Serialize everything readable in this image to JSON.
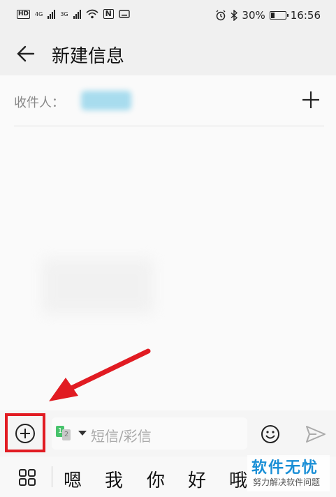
{
  "status_bar": {
    "hd": "HD",
    "net1": "4G",
    "net2": "3G",
    "nfc": "N",
    "battery_percent": "30%",
    "battery_level": 0.3,
    "time": "16:56",
    "icons": [
      "alarm-icon",
      "bluetooth-icon",
      "wifi-icon",
      "keyboard-icon"
    ]
  },
  "header": {
    "title": "新建信息"
  },
  "recipient": {
    "label": "收件人："
  },
  "compose": {
    "placeholder": "短信/彩信",
    "sim_1": "1",
    "sim_2": "2"
  },
  "keyboard": {
    "candidates": [
      "嗯",
      "我",
      "你",
      "好",
      "哦"
    ]
  },
  "watermark": {
    "title": "软件无忧",
    "subtitle": "努力解决软件问题"
  },
  "colors": {
    "highlight_red": "#e11b22",
    "sim_green": "#48c36c",
    "watermark_blue": "#1a8fd6"
  }
}
